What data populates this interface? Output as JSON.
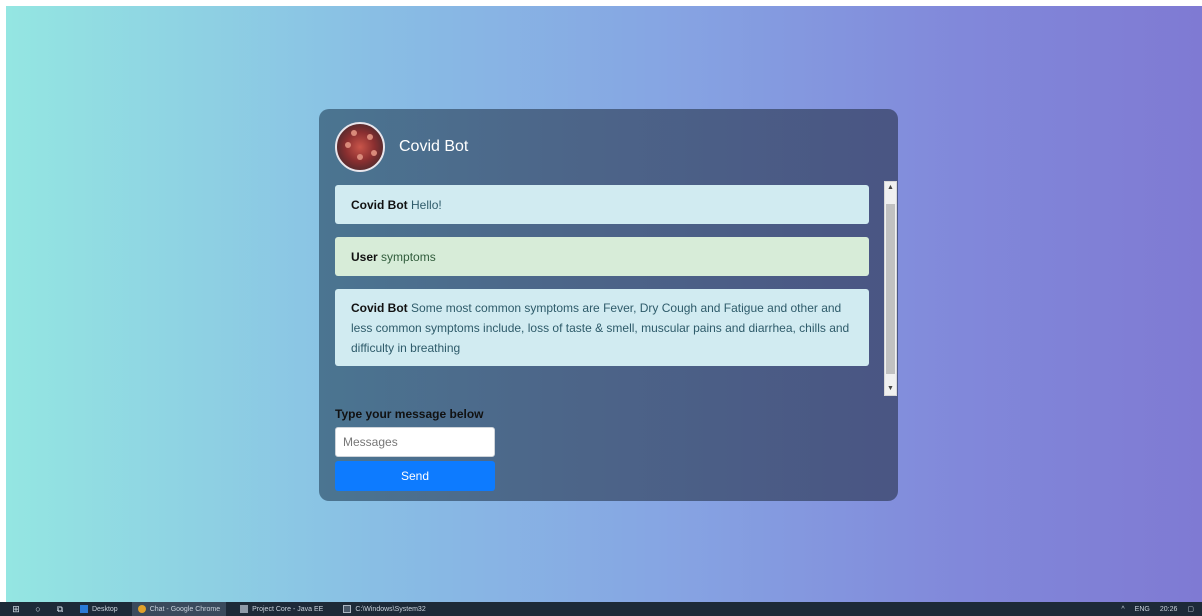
{
  "chat": {
    "bot_name": "Covid Bot",
    "messages": [
      {
        "sender": "Covid Bot",
        "text": "Hello!",
        "type": "bot"
      },
      {
        "sender": "User",
        "text": "symptoms",
        "type": "user"
      },
      {
        "sender": "Covid Bot",
        "text": "Some most common symptoms are Fever, Dry Cough and Fatigue and other and less common symptoms include, loss of taste & smell, muscular pains and diarrhea, chills and difficulty in breathing",
        "type": "bot"
      }
    ],
    "input_label": "Type your message below",
    "input_placeholder": "Messages",
    "input_value": "",
    "send_label": "Send"
  },
  "taskbar": {
    "items": [
      "Desktop",
      "Chat - Google Chrome",
      "Project Core - Java EE",
      "C:\\Windows\\System32"
    ],
    "tray": {
      "lang": "ENG",
      "time": "20:26"
    }
  },
  "colors": {
    "bg_start": "#94e6e2",
    "bg_end": "#7f7ad3",
    "card": "#4c6689",
    "bot_bubble": "#d1ebf1",
    "user_bubble": "#d7ecd8",
    "send_button": "#0d7bff"
  },
  "icons": [
    "windows-icon",
    "search-icon",
    "task-view-icon",
    "chrome-icon",
    "ide-icon",
    "terminal-icon",
    "chevron-up-icon",
    "notification-icon"
  ]
}
